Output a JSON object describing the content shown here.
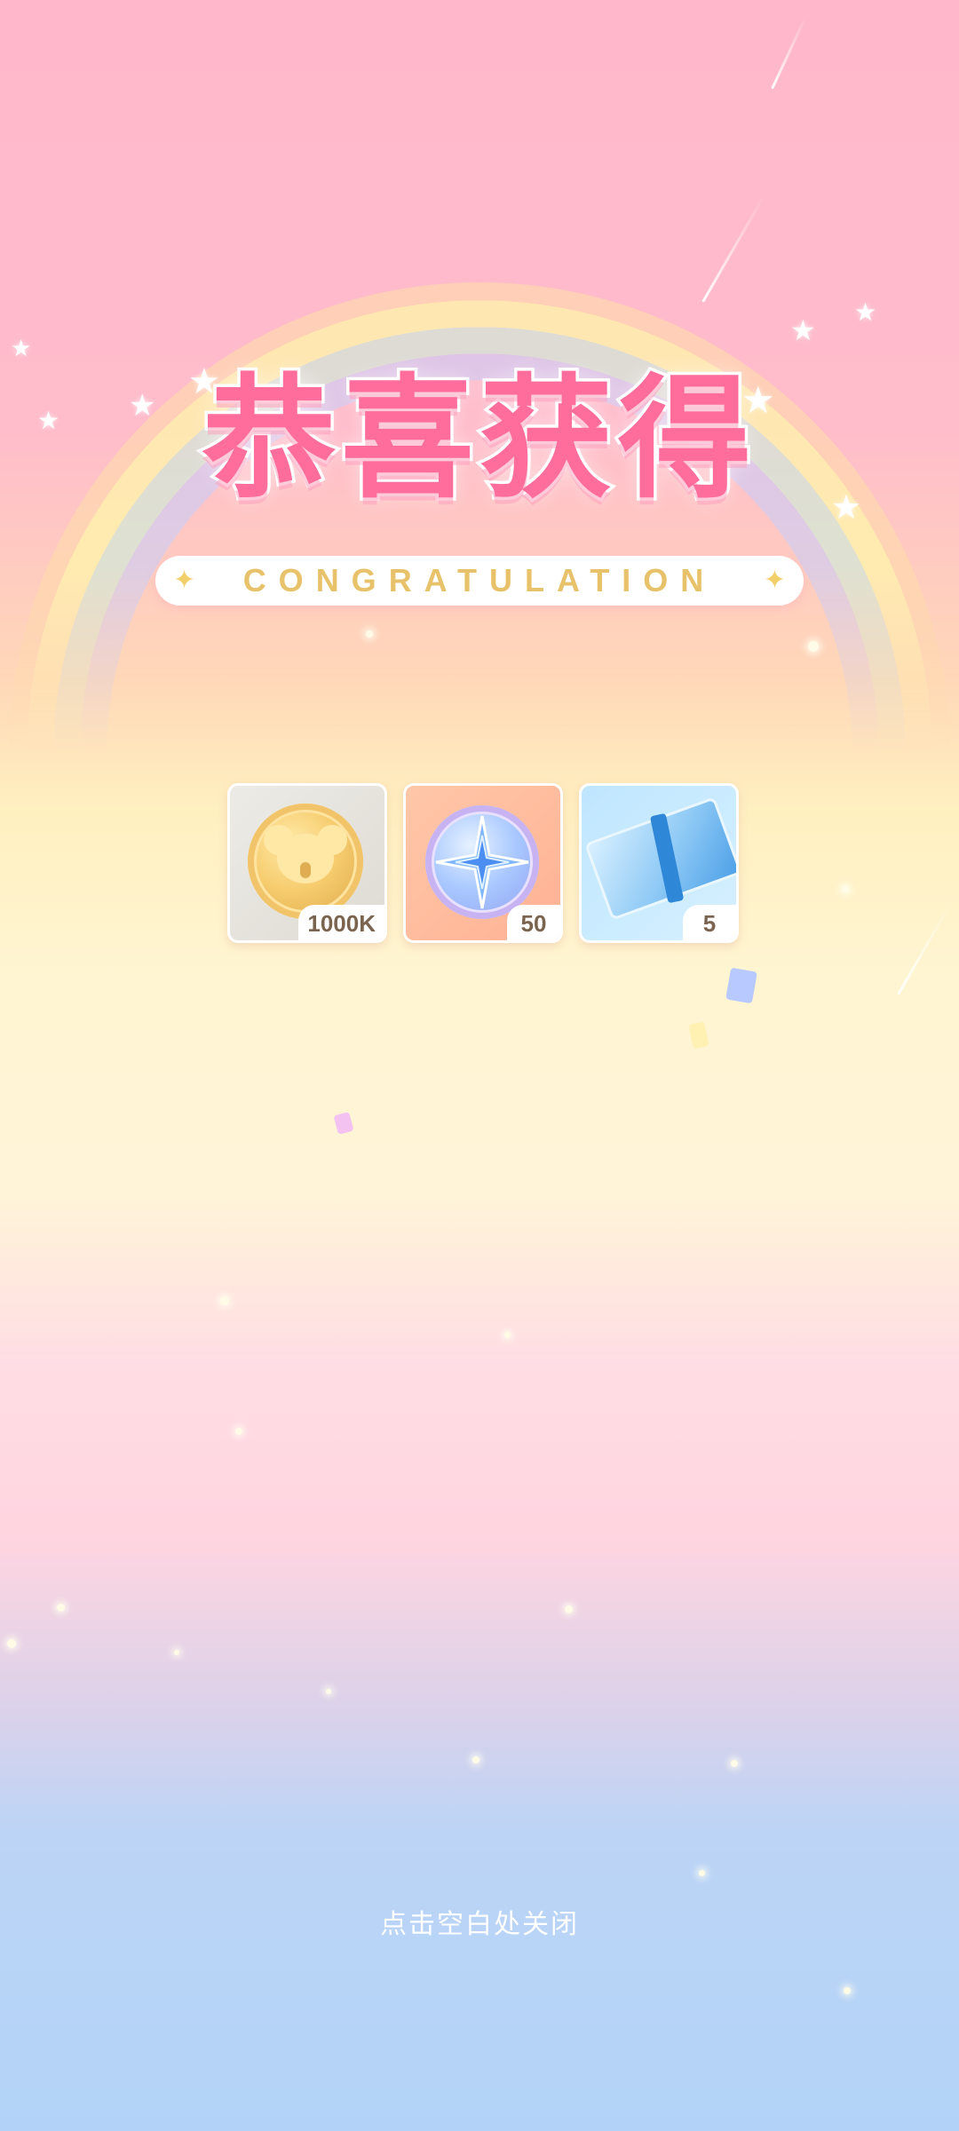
{
  "title": "恭喜获得",
  "subtitle": "CONGRATULATION",
  "rewards": [
    {
      "icon": "gold-koala-coin-icon",
      "quantity": "1000K"
    },
    {
      "icon": "blue-compass-star-coin-icon",
      "quantity": "50"
    },
    {
      "icon": "blue-ticket-icon",
      "quantity": "5"
    }
  ],
  "close_hint": "点击空白处关闭",
  "colors": {
    "title": "#ff6d9c",
    "subtitle": "#e8c26a",
    "badge_text": "#7a6450"
  }
}
